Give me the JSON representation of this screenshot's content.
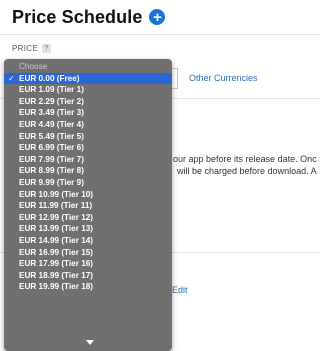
{
  "header": {
    "title": "Price Schedule",
    "add_icon": "plus-circle-icon",
    "add_symbol": "+"
  },
  "price": {
    "label": "PRICE",
    "help_symbol": "?"
  },
  "other_currencies": "Other Currencies",
  "background_text": {
    "line1": "our app before its release date. Onc",
    "line2": "will be charged before download. A"
  },
  "edit_link": "Edit",
  "dropdown": {
    "placeholder": "Choose",
    "check_symbol": "✓",
    "items": [
      "EUR 0.00 (Free)",
      "EUR 1.09 (Tier 1)",
      "EUR 2.29 (Tier 2)",
      "EUR 3.49 (Tier 3)",
      "EUR 4.49 (Tier 4)",
      "EUR 5.49 (Tier 5)",
      "EUR 6.99 (Tier 6)",
      "EUR 7.99 (Tier 7)",
      "EUR 8.99 (Tier 8)",
      "EUR 9.99 (Tier 9)",
      "EUR 10.99 (Tier 10)",
      "EUR 11.99 (Tier 11)",
      "EUR 12.99 (Tier 12)",
      "EUR 13.99 (Tier 13)",
      "EUR 14.99 (Tier 14)",
      "EUR 16.99 (Tier 15)",
      "EUR 17.99 (Tier 16)",
      "EUR 18.99 (Tier 17)",
      "EUR 19.99 (Tier 18)"
    ],
    "selected_index": 0
  },
  "colors": {
    "accent": "#1a73d9",
    "link": "#2a6db5",
    "menu_bg": "#707070",
    "highlight": "#2a66d6"
  }
}
